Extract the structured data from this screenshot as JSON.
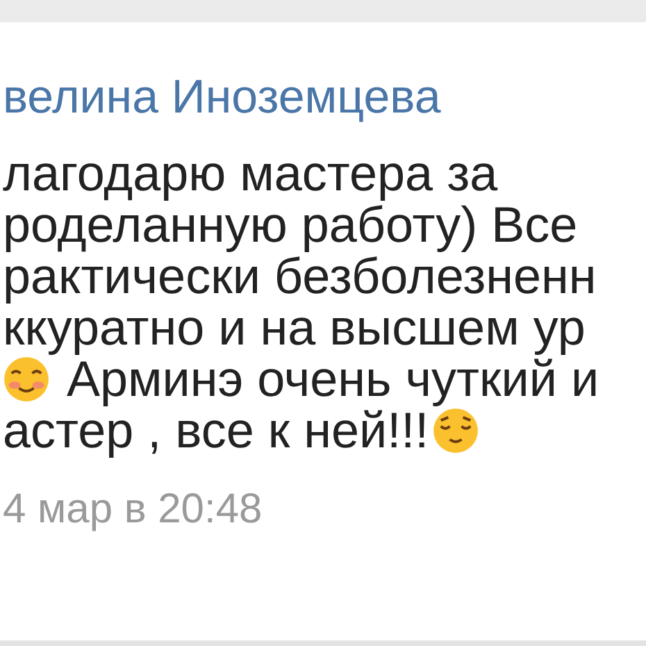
{
  "comment": {
    "author": "велина Иноземцева",
    "lines": [
      {
        "kind": "text",
        "text": "лагодарю мастера за"
      },
      {
        "kind": "text",
        "text": "роделанную работу) Все"
      },
      {
        "kind": "text",
        "text": "рактически безболезненн"
      },
      {
        "kind": "text",
        "text": "ккуратно и на высшем ур"
      },
      {
        "kind": "emoji_before",
        "text": "Арминэ очень чуткий и"
      },
      {
        "kind": "emoji_after",
        "text": "астер , все к ней!!!"
      }
    ],
    "time": "4 мар в 20:48"
  }
}
